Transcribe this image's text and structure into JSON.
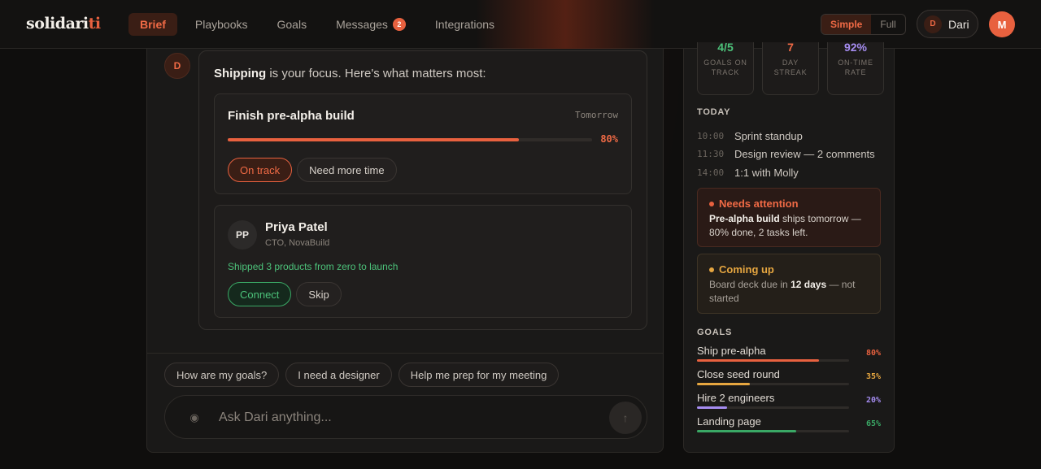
{
  "logo": {
    "main": "solidari",
    "accent": "ti"
  },
  "nav": [
    {
      "label": "Brief",
      "active": true
    },
    {
      "label": "Playbooks"
    },
    {
      "label": "Goals"
    },
    {
      "label": "Messages",
      "badge": "2"
    },
    {
      "label": "Integrations"
    }
  ],
  "mode": {
    "simple": "Simple",
    "full": "Full"
  },
  "user_chip": {
    "initial": "D",
    "name": "Dari"
  },
  "profile_initial": "M",
  "chat": {
    "bot_initial": "D",
    "intro_bold": "Shipping",
    "intro_rest": " is your focus. Here's what matters most:",
    "goal_card": {
      "title": "Finish pre-alpha build",
      "due": "Tomorrow",
      "progress": 80,
      "progress_label": "80%",
      "actions": [
        "On track",
        "Need more time"
      ]
    },
    "person_card": {
      "initials": "PP",
      "name": "Priya Patel",
      "role": "CTO, NovaBuild",
      "note": "Shipped 3 products from zero to launch",
      "actions": [
        "Connect",
        "Skip"
      ]
    },
    "suggestions": [
      "How are my goals?",
      "I need a designer",
      "Help me prep for my meeting"
    ],
    "composer_placeholder": "Ask Dari anything..."
  },
  "side": {
    "stats": [
      {
        "value": "4/5",
        "label": "GOALS ON TRACK",
        "color": "#4cc27a"
      },
      {
        "value": "7",
        "label": "DAY STREAK",
        "color": "#f06a45"
      },
      {
        "value": "92%",
        "label": "ON-TIME RATE",
        "color": "#a58cf0"
      }
    ],
    "today_title": "TODAY",
    "schedule": [
      {
        "time": "10:00",
        "text": "Sprint standup"
      },
      {
        "time": "11:30",
        "text": "Design review — 2 comments"
      },
      {
        "time": "14:00",
        "text": "1:1 with Molly"
      }
    ],
    "needs_attention": {
      "title": "Needs attention",
      "bold": "Pre-alpha build",
      "rest": " ships tomorrow — 80% done, 2 tasks left."
    },
    "coming_up": {
      "title": "Coming up",
      "pre": "Board deck due in ",
      "bold": "12 days",
      "rest": " — not started"
    },
    "goals_title": "GOALS",
    "goals": [
      {
        "name": "Ship pre-alpha",
        "pct": 80,
        "label": "80%",
        "color": "#e8613f"
      },
      {
        "name": "Close seed round",
        "pct": 35,
        "label": "35%",
        "color": "#e6a640"
      },
      {
        "name": "Hire 2 engineers",
        "pct": 20,
        "label": "20%",
        "color": "#a58cf0"
      },
      {
        "name": "Landing page",
        "pct": 65,
        "label": "65%",
        "color": "#3aa865"
      }
    ]
  }
}
